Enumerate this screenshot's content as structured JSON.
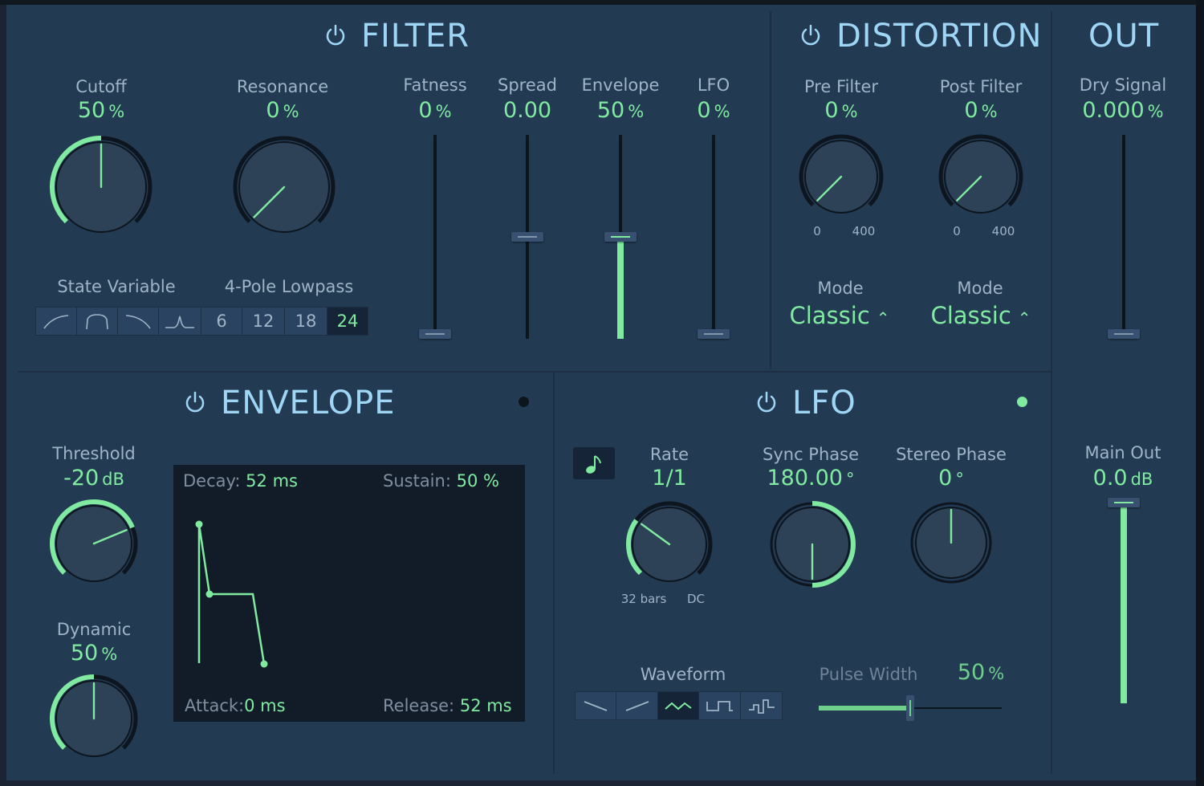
{
  "colors": {
    "accent": "#80eba0",
    "title": "#9fd6f5",
    "label": "#9fb4c6",
    "panel": "#233a53",
    "knob": "#2d4257",
    "inactive_text": "#7e8ea0"
  },
  "filter": {
    "title": "FILTER",
    "power_icon": "power-icon",
    "cutoff": {
      "label": "Cutoff",
      "value": "50",
      "unit": "%",
      "amount": 0.5
    },
    "resonance": {
      "label": "Resonance",
      "value": "0",
      "unit": "%",
      "amount": 0.0
    },
    "fatness": {
      "label": "Fatness",
      "value": "0",
      "unit": "%",
      "amount": 0.0
    },
    "spread": {
      "label": "Spread",
      "value": "0.00",
      "amount": 0.5
    },
    "envelope": {
      "label": "Envelope",
      "value": "50",
      "unit": "%",
      "amount": 0.5
    },
    "lfo": {
      "label": "LFO",
      "value": "0",
      "unit": "%",
      "amount": 0.0
    },
    "state_variable_label": "State Variable",
    "pole_label": "4-Pole Lowpass",
    "type_buttons": [
      "lowpass-icon",
      "bandpass-icon",
      "highpass-icon",
      "peak-icon"
    ],
    "slopes": [
      "6",
      "12",
      "18",
      "24"
    ],
    "active_slope": "24"
  },
  "distortion": {
    "title": "DISTORTION",
    "pre_filter": {
      "label": "Pre Filter",
      "value": "0",
      "unit": "%",
      "min": "0",
      "max": "400",
      "amount": 0.0,
      "mode_label": "Mode",
      "mode_value": "Classic"
    },
    "post_filter": {
      "label": "Post Filter",
      "value": "0",
      "unit": "%",
      "min": "0",
      "max": "400",
      "amount": 0.0,
      "mode_label": "Mode",
      "mode_value": "Classic"
    }
  },
  "out": {
    "title": "OUT",
    "dry_signal": {
      "label": "Dry Signal",
      "value": "0.000",
      "unit": "%",
      "amount": 0.0
    },
    "main_out": {
      "label": "Main Out",
      "value": "0.0",
      "unit": "dB",
      "amount": 1.0
    }
  },
  "envelope": {
    "title": "ENVELOPE",
    "threshold": {
      "label": "Threshold",
      "value": "-20",
      "unit": "dB",
      "amount": 0.75
    },
    "dynamic": {
      "label": "Dynamic",
      "value": "50",
      "unit": "%",
      "amount": 0.5
    },
    "decay_label": "Decay:",
    "decay_value": "52 ms",
    "sustain_label": "Sustain:",
    "sustain_value": "50 %",
    "attack_label": "Attack:",
    "attack_value": "0 ms",
    "release_label": "Release:",
    "release_value": "52 ms",
    "indicator_active": false
  },
  "lfo": {
    "title": "LFO",
    "sync_icon": "music-note-icon",
    "rate": {
      "label": "Rate",
      "value": "1/1",
      "min": "32 bars",
      "max": "DC",
      "amount": 0.3
    },
    "sync_phase": {
      "label": "Sync Phase",
      "value": "180.00",
      "unit": "°",
      "amount": 0.5
    },
    "stereo_phase": {
      "label": "Stereo Phase",
      "value": "0",
      "unit": "°",
      "amount": 0.0
    },
    "waveform_label": "Waveform",
    "waveforms": [
      "saw-down-icon",
      "saw-up-icon",
      "triangle-icon",
      "square-icon",
      "random-pulse-icon"
    ],
    "active_waveform": 2,
    "pulse_width": {
      "label": "Pulse Width",
      "value": "50",
      "unit": "%",
      "amount": 0.5
    },
    "indicator_active": true
  }
}
